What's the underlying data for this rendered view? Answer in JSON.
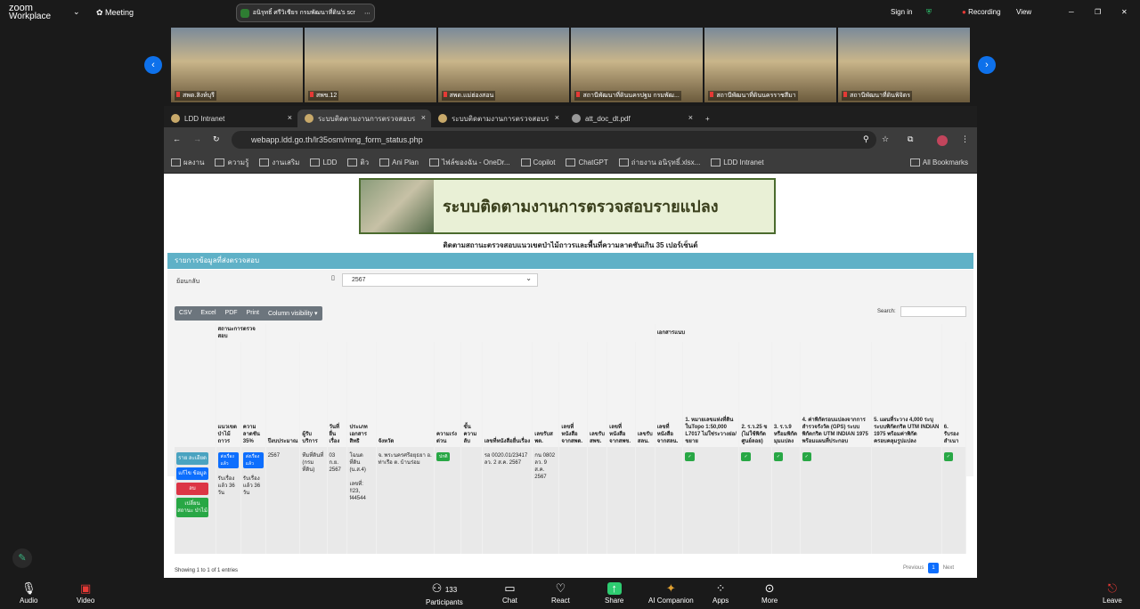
{
  "zoom": {
    "brand_line1": "zoom",
    "brand_line2": "Workplace",
    "meeting_label": "Meeting",
    "share_title": "อนิรุทธิ์ ศรีวิเชียร กรมพัฒนาที่ดิน's scr",
    "signin": "Sign in",
    "recording": "Recording",
    "view": "View"
  },
  "participants": [
    {
      "name": "สพด.สิงห์บุรี"
    },
    {
      "name": "สพข.12"
    },
    {
      "name": "สพด.แม่ฮ่องสอน"
    },
    {
      "name": "สถานีพัฒนาที่ดินนครปฐม กรมพัฒ..."
    },
    {
      "name": "สถานีพัฒนาที่ดินนครราชสีมา"
    },
    {
      "name": "สถานีพัฒนาที่ดินพิจิตร"
    }
  ],
  "browser": {
    "tabs": [
      {
        "label": "LDD Intranet"
      },
      {
        "label": "ระบบติดตามงานการตรวจสอบราย"
      },
      {
        "label": "ระบบติดตามงานการตรวจสอบราย"
      },
      {
        "label": "att_doc_dt.pdf"
      }
    ],
    "url": "webapp.ldd.go.th/lr35osm/mng_form_status.php",
    "bookmarks": [
      "ผลงาน",
      "ความรู้",
      "งานเสริม",
      "LDD",
      "ติว",
      "Ani Plan",
      "ไฟล์ของฉัน - OneDr...",
      "Copilot",
      "ChatGPT",
      "ถ่ายงาน อนิรุทธิ์.xlsx...",
      "LDD Intranet"
    ],
    "all_bookmarks": "All Bookmarks"
  },
  "page": {
    "banner_title": "ระบบติดตามงานการตรวจสอบรายแปลง",
    "subtitle": "ติดตามสถานะตรวจสอบแนวเขตป่าไม้ถาวรและพื้นที่ความลาดชันเกิน 35 เปอร์เซ็นต์",
    "section": "รายการข้อมูลที่ส่งตรวจสอบ",
    "filter_label": "ย้อนกลับ",
    "filter_value": "2567",
    "buttons": [
      "CSV",
      "Excel",
      "PDF",
      "Print",
      "Column visibility ▾"
    ],
    "search_label": "Search:",
    "group_status": "สถานะการตรวจสอบ",
    "group_docs": "เอกสารแนบ",
    "headers": [
      "แนวเขตป่าไม้ถาวร",
      "ความลาดชัน 35%",
      "ปีงบประมาณ",
      "ผู้รับบริการ",
      "วันที่ยื่นเรื่อง",
      "ประเภทเอกสารสิทธิ",
      "จังหวัด",
      "ความเร่งด่วน",
      "ขั้นความลับ",
      "เลขที่หนังสือยื่นเรื่อง",
      "เลขรับสพด.",
      "เลขที่หนังสือจากสพด.",
      "เลขรับสพข.",
      "เลขที่หนังสือจากสพข.",
      "เลขรับสลน.",
      "เลขที่หนังสือจากสลน.",
      "1. หมายเลขแห่งที่ดินในTopo 1:50,000 L7017 ไม่ใช่ระวางย่อ/ขยาย",
      "2. ร.ว.25 ข (ไม่ใช้พิกัดศูนย์ลอย)",
      "3. ร.ว.9 หรือมพิกัดมุมแปลง",
      "4. ค่าพิกัดรอบแปลงจากการสำรวจรังวัด (GPS) ระบบพิกัดกริด UTM INDIAN 1975 พร้อมแผนที่ประกอบ",
      "5. แผนที่ระวาง 4,000 ระบุระบบพิกัดกริด UTM INDIAN 1975 พร้อมค่าพิกัดครอบคลุมรูปแปลง",
      "6. รับรองสำเนา"
    ],
    "row": {
      "actions": [
        "ราย ละเอียด",
        "แก้ไข ข้อมูล",
        "ลบ",
        "เปลี่ยน สถานะ ป่าไม้"
      ],
      "forest_badge": "ส่งเรื่องแล้ว",
      "forest_note": "รับเรื่องแล้ว 36 วัน",
      "slope_badge": "ส่งเรื่องแล้ว",
      "slope_note": "รับเรื่องแล้ว 36 วัน",
      "year": "2567",
      "client": "ทีมที่ดินที่ (กรมที่ดิน)",
      "date": "03 ก.ย. 2567",
      "doc_type": "โฉนดที่ดิน (น.ส.4)\n\nเลขที่: !!23, f44544",
      "province": "จ. พระนครศรีอยุธยา อ. ท่าเรือ ต. บ้านร่อม",
      "urgency": "ปกติ",
      "letter": "รอ 0020.01/23417 ลว. 2 ส.ค. 2567",
      "recv": "กน 0802 ลว. 9 ส.ค. 2567",
      "ok": "✓"
    },
    "footer": "Showing 1 to 1 of 1 entries",
    "pager": [
      "Previous",
      "1",
      "Next"
    ]
  },
  "toolbar": {
    "audio": "Audio",
    "video": "Video",
    "participants": "Participants",
    "participants_count": "133",
    "chat": "Chat",
    "react": "React",
    "share": "Share",
    "ai": "AI Companion",
    "apps": "Apps",
    "more": "More",
    "leave": "Leave"
  }
}
